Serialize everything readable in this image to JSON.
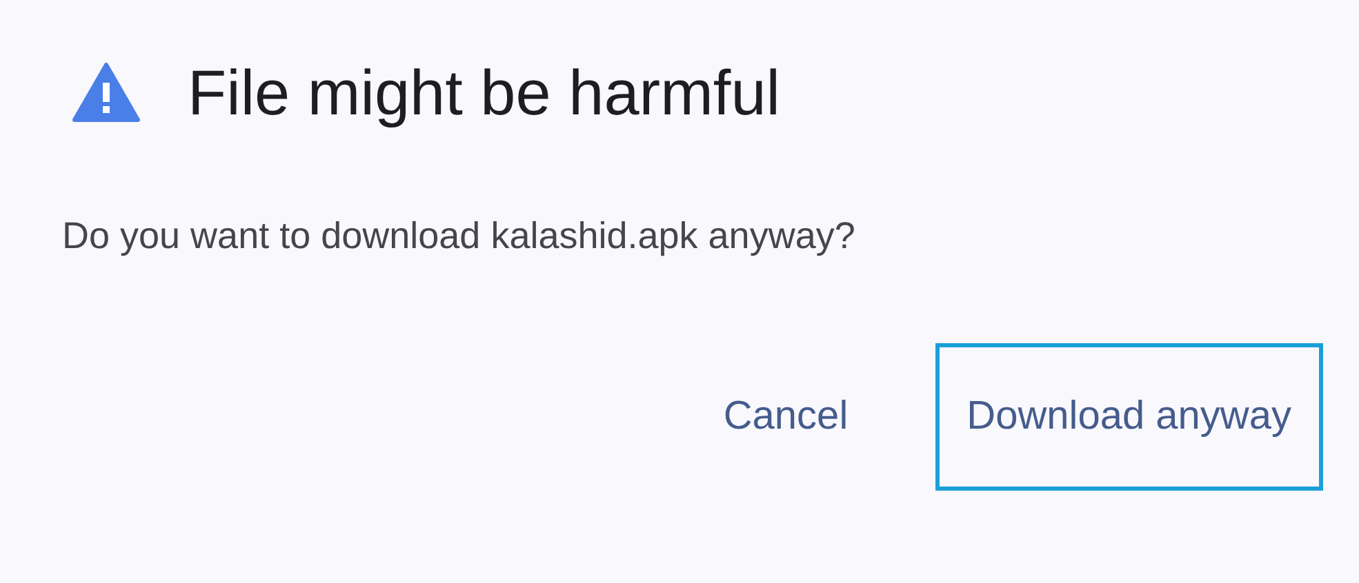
{
  "dialog": {
    "title": "File might be harmful",
    "message": "Do you want to download kalashid.apk anyway?",
    "buttons": [
      {
        "label": "Cancel",
        "focused": false
      },
      {
        "label": "Download anyway",
        "focused": true
      }
    ]
  }
}
